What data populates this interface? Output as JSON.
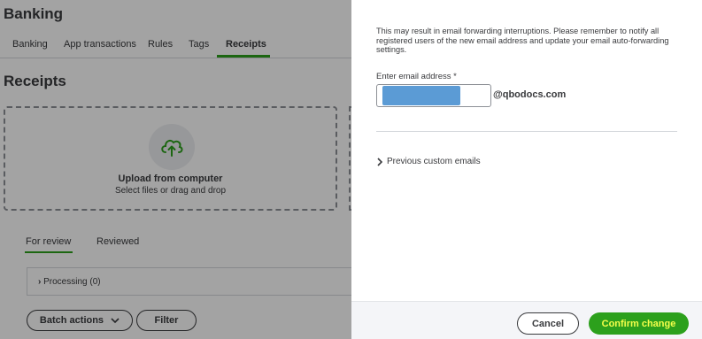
{
  "header": {
    "title": "Banking"
  },
  "tabs": [
    {
      "label": "Banking"
    },
    {
      "label": "App transactions"
    },
    {
      "label": "Rules"
    },
    {
      "label": "Tags"
    },
    {
      "label": "Receipts",
      "active": true
    }
  ],
  "receipts": {
    "title": "Receipts",
    "upload": {
      "icon": "cloud-upload-icon",
      "label": "Upload from computer",
      "sublabel": "Select files or drag and drop"
    },
    "review_tabs": [
      {
        "label": "For review",
        "active": true
      },
      {
        "label": "Reviewed"
      }
    ],
    "processing": "Processing (0)",
    "batch_actions": "Batch actions",
    "filter": "Filter"
  },
  "drawer": {
    "notice": "This may result in email forwarding interruptions. Please remember to notify all registered users of the new email address and update your email auto-forwarding settings.",
    "email_label": "Enter email address *",
    "email_domain": "@qbodocs.com",
    "previous_custom_emails": "Previous custom emails",
    "cancel": "Cancel",
    "confirm": "Confirm change"
  },
  "colors": {
    "accent": "#2ca01c",
    "confirm_text": "#f5ff4a",
    "redaction": "#5b9bd5"
  }
}
